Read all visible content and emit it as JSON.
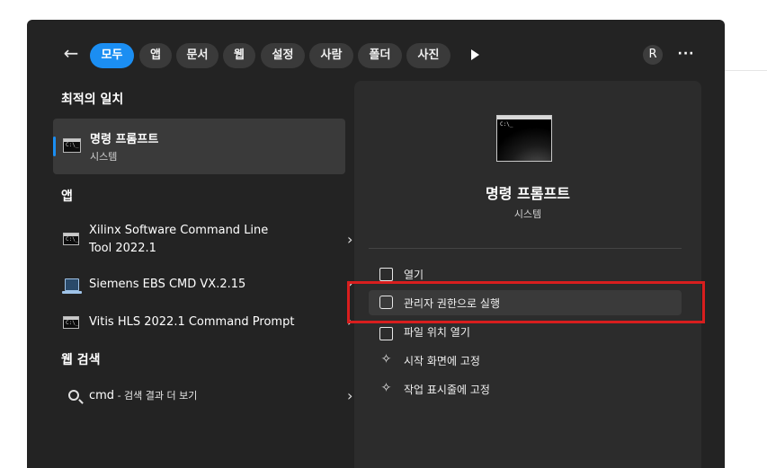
{
  "topbar": {
    "back": "←",
    "filters": [
      "모두",
      "앱",
      "문서",
      "웹",
      "설정",
      "사람",
      "폴더",
      "사진"
    ],
    "active_filter": "모두",
    "avatar": "R",
    "more": "···"
  },
  "sections": {
    "best_match": "최적의 일치",
    "apps": "앱",
    "web": "웹 검색"
  },
  "best_match": {
    "title": "명령 프롬프트",
    "subtitle": "시스템",
    "icon": "cmd-icon"
  },
  "apps": [
    {
      "title_line1": "Xilinx Software Command Line",
      "title_line2": "Tool 2022.1",
      "icon": "cmd-icon"
    },
    {
      "title_line1": "Siemens EBS CMD VX.2.15",
      "title_line2": "",
      "icon": "terminal-icon"
    },
    {
      "title_line1": "Vitis HLS 2022.1 Command Prompt",
      "title_line2": "",
      "icon": "cmd-icon"
    }
  ],
  "web_search": {
    "query": "cmd",
    "suffix": " - 검색 결과 더 보기"
  },
  "chevron": "›",
  "detail": {
    "title": "명령 프롬프트",
    "subtitle": "시스템",
    "actions": [
      {
        "label": "열기",
        "icon": "open-icon"
      },
      {
        "label": "관리자 권한으로 실행",
        "icon": "shield-icon",
        "highlighted": true
      },
      {
        "label": "파일 위치 열기",
        "icon": "folder-icon"
      },
      {
        "label": "시작 화면에 고정",
        "icon": "pin-icon"
      },
      {
        "label": "작업 표시줄에 고정",
        "icon": "pin-icon"
      }
    ]
  },
  "colors": {
    "accent": "#1b8ef2",
    "panel": "#232323",
    "annotation": "#d81e1e"
  }
}
